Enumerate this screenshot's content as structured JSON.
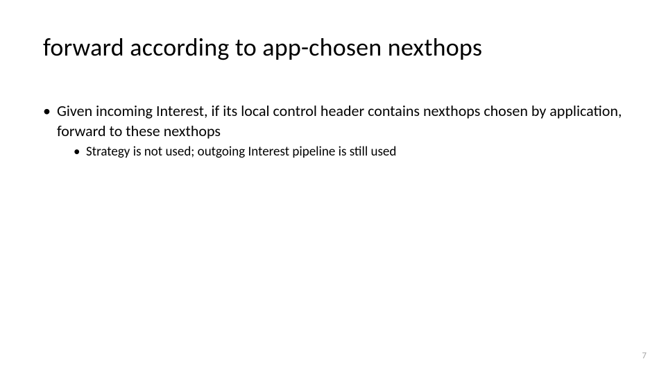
{
  "slide": {
    "title": "forward according to app-chosen nexthops",
    "bullets": [
      {
        "text": "Given incoming Interest, if its local control header contains nexthops chosen by application, forward to these nexthops",
        "sub": [
          {
            "text": "Strategy is not used; outgoing Interest pipeline is still used"
          }
        ]
      }
    ],
    "page_number": "7"
  }
}
